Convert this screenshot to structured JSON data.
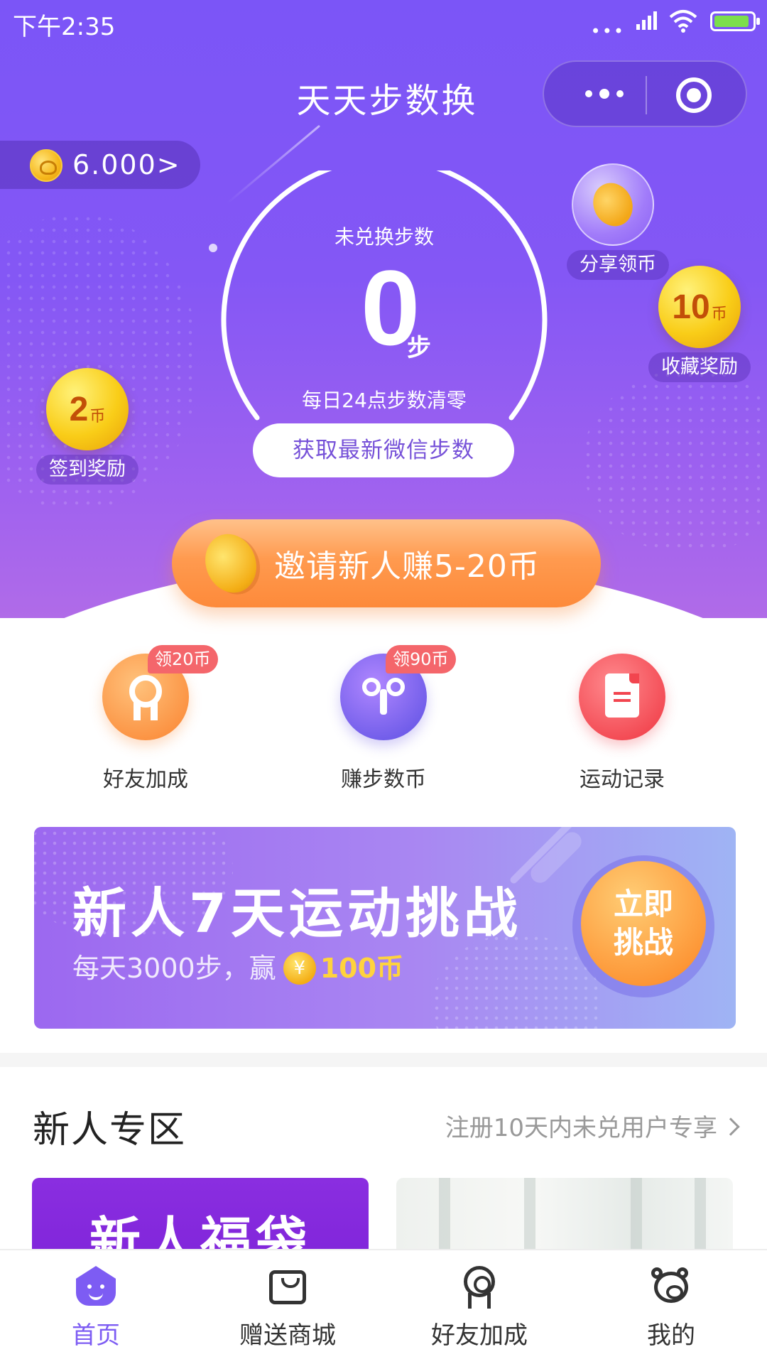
{
  "status_bar": {
    "time": "下午2:35",
    "dots": "•••"
  },
  "nav": {
    "title": "天天步数换"
  },
  "balance": {
    "amount": "6.000>"
  },
  "gauge": {
    "caption": "未兑换步数",
    "steps": "0",
    "unit": "步",
    "reset_note": "每日24点步数清零",
    "refresh_label": "获取最新微信步数"
  },
  "floats": {
    "share": {
      "label": "分享领币"
    },
    "favorite": {
      "amount": "10",
      "currency": "币",
      "label": "收藏奖励"
    },
    "checkin": {
      "amount": "2",
      "currency": "币",
      "label": "签到奖励"
    }
  },
  "invite": {
    "label": "邀请新人赚5-20币"
  },
  "features": [
    {
      "label": "好友加成",
      "badge": "领20币"
    },
    {
      "label": "赚步数币",
      "badge": "领90币"
    },
    {
      "label": "运动记录"
    }
  ],
  "challenge": {
    "title": "新人7天运动挑战",
    "sub_prefix": "每天3000步，赢",
    "yen": "¥",
    "reward": "100币",
    "button": "立即挑战"
  },
  "new_user_zone": {
    "title": "新人专区",
    "more": "注册10天内未兑用户专享",
    "card_a": "新人福袋"
  },
  "tabs": [
    {
      "label": "首页",
      "active": true
    },
    {
      "label": "赠送商城"
    },
    {
      "label": "好友加成"
    },
    {
      "label": "我的"
    }
  ],
  "colors": {
    "brand_purple": "#7b55f7",
    "orange": "#fd8a3a",
    "gold": "#f9cd18",
    "tab_active": "#7d5cf3"
  }
}
